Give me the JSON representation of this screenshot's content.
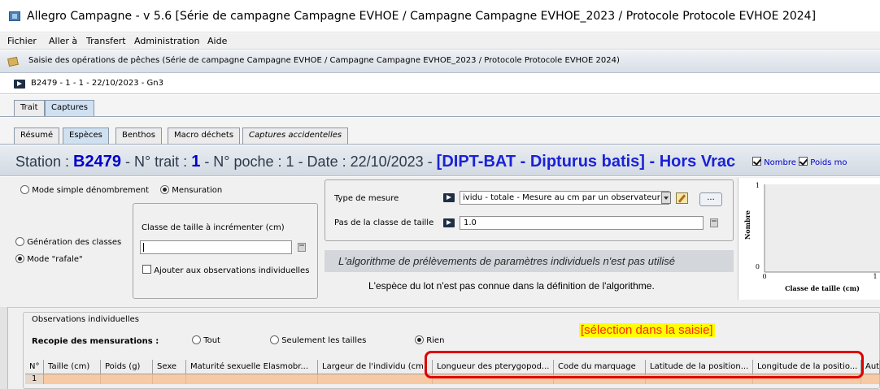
{
  "window": {
    "title": "Allegro Campagne - v 5.6 [Série de campagne Campagne EVHOE / Campagne Campagne EVHOE_2023 / Protocole Protocole EVHOE 2024]"
  },
  "menu": [
    "Fichier",
    "Aller à",
    "Transfert",
    "Administration",
    "Aide"
  ],
  "panel": {
    "title": "Saisie des opérations de pêches (Série de campagne Campagne EVHOE / Campagne Campagne EVHOE_2023 / Protocole Protocole EVHOE 2024)"
  },
  "breadcrumb": "B2479 - 1 - 1 - 22/10/2023 - Gn3",
  "tabs_main": [
    {
      "label": "Trait",
      "active": false
    },
    {
      "label": "Captures",
      "active": true
    }
  ],
  "tabs_sub": [
    {
      "label": "Résumé",
      "active": false
    },
    {
      "label": "Espèces",
      "active": true
    },
    {
      "label": "Benthos",
      "active": false
    },
    {
      "label": "Macro déchets",
      "active": false
    },
    {
      "label": "Captures accidentelles",
      "active": false
    }
  ],
  "station": {
    "prefix": "Station : ",
    "station_value": "B2479",
    "trait_label": " - N° trait : ",
    "trait_value": "1",
    "poche_label": " - N° poche : 1 - Date : 22/10/2023 - ",
    "lot": "[DIPT-BAT - Dipturus batis] - Hors Vrac",
    "check_nombre": "Nombre",
    "check_poids": "Poids mo"
  },
  "mode": {
    "simple": "Mode simple dénombrement",
    "mensuration": "Mensuration",
    "generation": "Génération des classes",
    "rafale": "Mode \"rafale\"",
    "classe_label": "Classe de taille à incrémenter (cm)",
    "classe_value": "",
    "ajouter": "Ajouter aux observations individuelles"
  },
  "mesure": {
    "type_label": "Type de mesure",
    "type_value": "ividu - totale - Mesure au cm par un observateur",
    "pas_label": "Pas de la classe de taille",
    "pas_value": "1.0",
    "dots": "..."
  },
  "algo": {
    "line1": "L'algorithme de prélèvements de paramètres individuels n'est pas utilisé",
    "line2": "L'espèce du lot n'est pas connue dans la définition de l'algorithme."
  },
  "chart_data": {
    "type": "bar",
    "categories": [],
    "values": [],
    "title": "",
    "xlabel": "Classe de taille (cm)",
    "ylabel": "Nombre",
    "y_ticks": [
      "1",
      "0"
    ],
    "x_ticks": [
      "0",
      "1"
    ]
  },
  "observations": {
    "title": "Observations individuelles",
    "recopie_label": "Recopie des mensurations :",
    "opt_tout": "Tout",
    "opt_tailles": "Seulement les tailles",
    "opt_rien": "Rien",
    "columns": [
      "N°",
      "Taille (cm)",
      "Poids (g)",
      "Sexe",
      "Maturité sexuelle Elasmobr...",
      "Largeur de l'individu (cm)",
      "Longueur des pterygopod...",
      "Code du marquage",
      "Latitude de la position...",
      "Longitude de la positio...",
      "Autr"
    ],
    "rows": [
      [
        "1",
        "",
        "",
        "",
        "",
        "",
        "",
        "",
        "",
        "",
        ""
      ]
    ]
  },
  "annotation": {
    "label": "[sélection dans la saisie]",
    "color": "#e00000"
  }
}
